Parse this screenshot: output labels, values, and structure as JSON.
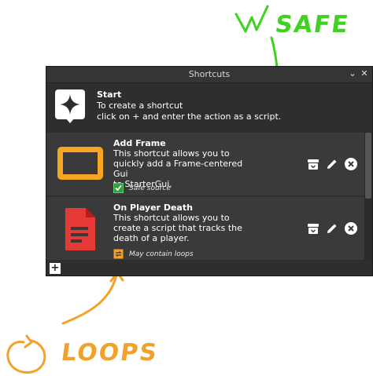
{
  "annotations": {
    "safe": "SAFE",
    "loops": "LOOPS"
  },
  "window": {
    "title": "Shortcuts",
    "collapse_icon": "chevron-down-icon",
    "close_icon": "close-icon"
  },
  "start": {
    "heading": "Start",
    "line1": "To create a shortcut",
    "line2": "click on + and enter the action as a script.",
    "icon": "sparkle-icon"
  },
  "shortcuts": [
    {
      "title": "Add Frame",
      "line1": "This shortcut allows you to",
      "line2": "quickly add a Frame-centered Gui",
      "line3": "to StarterGui.",
      "tag": "Safe source",
      "icon": "frame-icon",
      "tag_icon": "checkbox-icon",
      "accent": "#f5a623"
    },
    {
      "title": "On Player Death",
      "line1": "This shortcut allows you to",
      "line2": "create a script that tracks the",
      "line3": "death of a player.",
      "tag": "May contain loops",
      "icon": "document-icon",
      "tag_icon": "loop-icon",
      "accent": "#e53935"
    }
  ],
  "footer": {
    "add_label": "+"
  },
  "colors": {
    "safe_green": "#3fd21f",
    "loops_orange": "#f2a12a",
    "panel_bg": "#2e2e2e",
    "item_bg": "#3a3a3a"
  }
}
